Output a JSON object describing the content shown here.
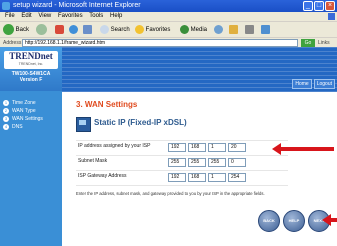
{
  "window": {
    "title": "setup wizard - Microsoft Internet Explorer"
  },
  "menu": [
    "File",
    "Edit",
    "View",
    "Favorites",
    "Tools",
    "Help"
  ],
  "toolbar": {
    "back": "Back",
    "search": "Search",
    "favorites": "Favorites",
    "media": "Media"
  },
  "address": {
    "label": "Address",
    "url": "http://192.168.1.1/frame_wizard.htm",
    "go": "Go",
    "links": "Links"
  },
  "brand": {
    "logo": "TRENDnet",
    "tagline": "TRENDnet, Inc.",
    "model": "TW100-S4W1CA",
    "version": "Version F"
  },
  "steps": [
    {
      "num": "1",
      "label": "Time Zone"
    },
    {
      "num": "2",
      "label": "WAN Type"
    },
    {
      "num": "3",
      "label": "WAN Settings"
    },
    {
      "num": "4",
      "label": "DNS"
    }
  ],
  "header_buttons": {
    "home": "Home",
    "logout": "Logout"
  },
  "section_title": "3. WAN Settings",
  "static_title": "Static IP (Fixed-IP xDSL)",
  "fields": [
    {
      "label": "IP address assigned by your ISP",
      "octets": [
        "192",
        "168",
        "1",
        "20"
      ]
    },
    {
      "label": "Subnet Mask",
      "octets": [
        "255",
        "255",
        "255",
        "0"
      ]
    },
    {
      "label": "ISP Gateway Address",
      "octets": [
        "192",
        "168",
        "1",
        "254"
      ]
    }
  ],
  "instructions": "Enter the IP address, subnet mask, and gateway provided to you by your ISP in the appropriate fields.",
  "nav": {
    "back": "BACK",
    "help": "HELP",
    "next": "NEXT"
  },
  "colors": {
    "accent": "#e04a1e",
    "arrow": "#d8151b",
    "panel": "#3a8fd6",
    "header": "#2468c3"
  }
}
